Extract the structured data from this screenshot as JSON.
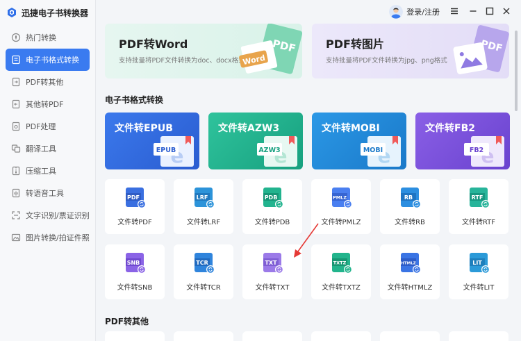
{
  "app": {
    "name": "迅捷电子书转换器"
  },
  "header": {
    "login_label": "登录/注册"
  },
  "sidebar": {
    "items": [
      {
        "label": "热门转换",
        "icon": "hot-icon",
        "active": false
      },
      {
        "label": "电子书格式转换",
        "icon": "ebook-icon",
        "active": true
      },
      {
        "label": "PDF转其他",
        "icon": "pdf-to-other-icon",
        "active": false
      },
      {
        "label": "其他转PDF",
        "icon": "other-to-pdf-icon",
        "active": false
      },
      {
        "label": "PDF处理",
        "icon": "pdf-process-icon",
        "active": false
      },
      {
        "label": "翻译工具",
        "icon": "translate-icon",
        "active": false
      },
      {
        "label": "压缩工具",
        "icon": "compress-icon",
        "active": false
      },
      {
        "label": "转语音工具",
        "icon": "voice-icon",
        "active": false
      },
      {
        "label": "文字识别/票证识别",
        "icon": "ocr-icon",
        "active": false
      },
      {
        "label": "图片转换/拍证件照",
        "icon": "image-icon",
        "active": false
      }
    ]
  },
  "top_cards": [
    {
      "title": "PDF转Word",
      "subtitle": "支持批量将PDF文件转换为doc、docx格式",
      "badge": "Word",
      "mark": "PDF"
    },
    {
      "title": "PDF转图片",
      "subtitle": "支持批量将PDF文件转换为jpg、png格式",
      "mark": "PDF"
    }
  ],
  "section_ebook": {
    "title": "电子书格式转换"
  },
  "ebook_cards": [
    {
      "title": "文件转EPUB",
      "tag": "EPUB"
    },
    {
      "title": "文件转AZW3",
      "tag": "AZW3"
    },
    {
      "title": "文件转MOBI",
      "tag": "MOBI"
    },
    {
      "title": "文件转FB2",
      "tag": "FB2"
    }
  ],
  "tiles_row1": [
    {
      "label": "文件转PDF",
      "tag": "PDF"
    },
    {
      "label": "文件转LRF",
      "tag": "LRF"
    },
    {
      "label": "文件转PDB",
      "tag": "PDB"
    },
    {
      "label": "文件转PMLZ",
      "tag": "PMLZ"
    },
    {
      "label": "文件转RB",
      "tag": "RB"
    },
    {
      "label": "文件转RTF",
      "tag": "RTF"
    }
  ],
  "tiles_row2": [
    {
      "label": "文件转SNB",
      "tag": "SNB"
    },
    {
      "label": "文件转TCR",
      "tag": "TCR"
    },
    {
      "label": "文件转TXT",
      "tag": "TXT"
    },
    {
      "label": "文件转TXTZ",
      "tag": "TXTZ"
    },
    {
      "label": "文件转HTMLZ",
      "tag": "HTMLZ"
    },
    {
      "label": "文件转LIT",
      "tag": "LIT"
    }
  ],
  "section_pdf_other": {
    "title": "PDF转其他"
  },
  "colors": {
    "accent": "#3a7bf0",
    "epub": "#2f66d8",
    "azw3": "#1fae8c",
    "mobi": "#1f86d4",
    "fb2": "#7a50da",
    "arrow": "#e53935"
  }
}
